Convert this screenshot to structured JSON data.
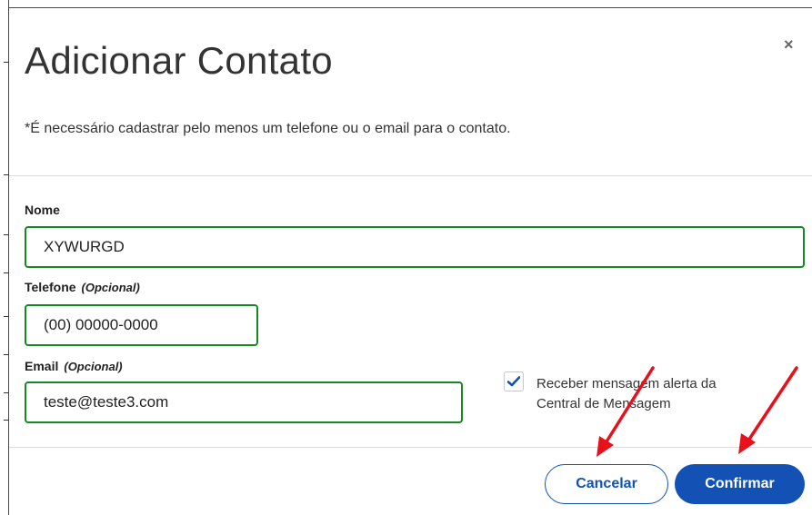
{
  "dialog": {
    "title": "Adicionar Contato",
    "close_label": "×",
    "notice": "*É necessário cadastrar pelo menos um telefone ou o email para o contato."
  },
  "form": {
    "nome": {
      "label": "Nome",
      "value": "XYWURGD"
    },
    "telefone": {
      "label": "Telefone",
      "optional": "(Opcional)",
      "value": "(00) 00000-0000"
    },
    "email": {
      "label": "Email",
      "optional": "(Opcional)",
      "value": "teste@teste3.com"
    },
    "alert_checkbox": {
      "checked": true,
      "label": "Receber mensagem alerta da Central de Mensagem"
    }
  },
  "footer": {
    "cancel_label": "Cancelar",
    "confirm_label": "Confirmar"
  },
  "colors": {
    "accent": "#1351b4",
    "field_border": "#168821",
    "annotation_arrow": "#e8101a"
  },
  "icons": {
    "close": "close-icon",
    "check": "check-icon",
    "annotation": "red-arrow-icon"
  }
}
